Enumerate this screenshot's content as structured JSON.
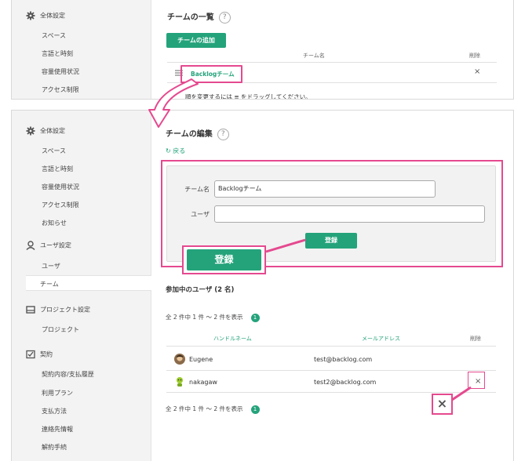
{
  "top": {
    "sidebar": [
      "全体設定",
      "スペース",
      "言語と時刻",
      "容量使用状況",
      "アクセス制限"
    ],
    "title": "チームの一覧",
    "help": "?",
    "add_button": "チームの追加",
    "col_name": "チーム名",
    "col_delete": "削除",
    "team_name": "Backlogチーム",
    "delete_mark": "×",
    "drag_hint": "順を変更するには ≡ をドラッグしてください。"
  },
  "bottom": {
    "sidebar": {
      "general": "全体設定",
      "general_items": [
        "スペース",
        "言語と時刻",
        "容量使用状況",
        "アクセス制限",
        "お知らせ"
      ],
      "user": "ユーザ設定",
      "user_items": [
        "ユーザ",
        "チーム"
      ],
      "project": "プロジェクト設定",
      "project_items": [
        "プロジェクト"
      ],
      "contract": "契約",
      "contract_items": [
        "契約内容/支払履歴",
        "利用プラン",
        "支払方法",
        "連絡先情報",
        "解約手続"
      ]
    },
    "title": "チームの編集",
    "help": "?",
    "back": "戻る",
    "form": {
      "team_label": "チーム名",
      "team_value": "Backlogチーム",
      "user_label": "ユーザ",
      "user_value": "",
      "submit": "登録",
      "submit_zoom": "登録"
    },
    "members_title": "参加中のユーザ (2 名)",
    "pager": "全 2 件中 1 件 〜 2 件を表示",
    "page": "1",
    "col_handle": "ハンドルネーム",
    "col_email": "メールアドレス",
    "col_delete": "削除",
    "members": [
      {
        "name": "Eugene",
        "email": "test@backlog.com"
      },
      {
        "name": "nakagaw",
        "email": "test2@backlog.com"
      }
    ],
    "delete_mark": "×",
    "delete_zoom": "×"
  },
  "colors": {
    "accent": "#24a37b",
    "highlight": "#e5498f"
  }
}
